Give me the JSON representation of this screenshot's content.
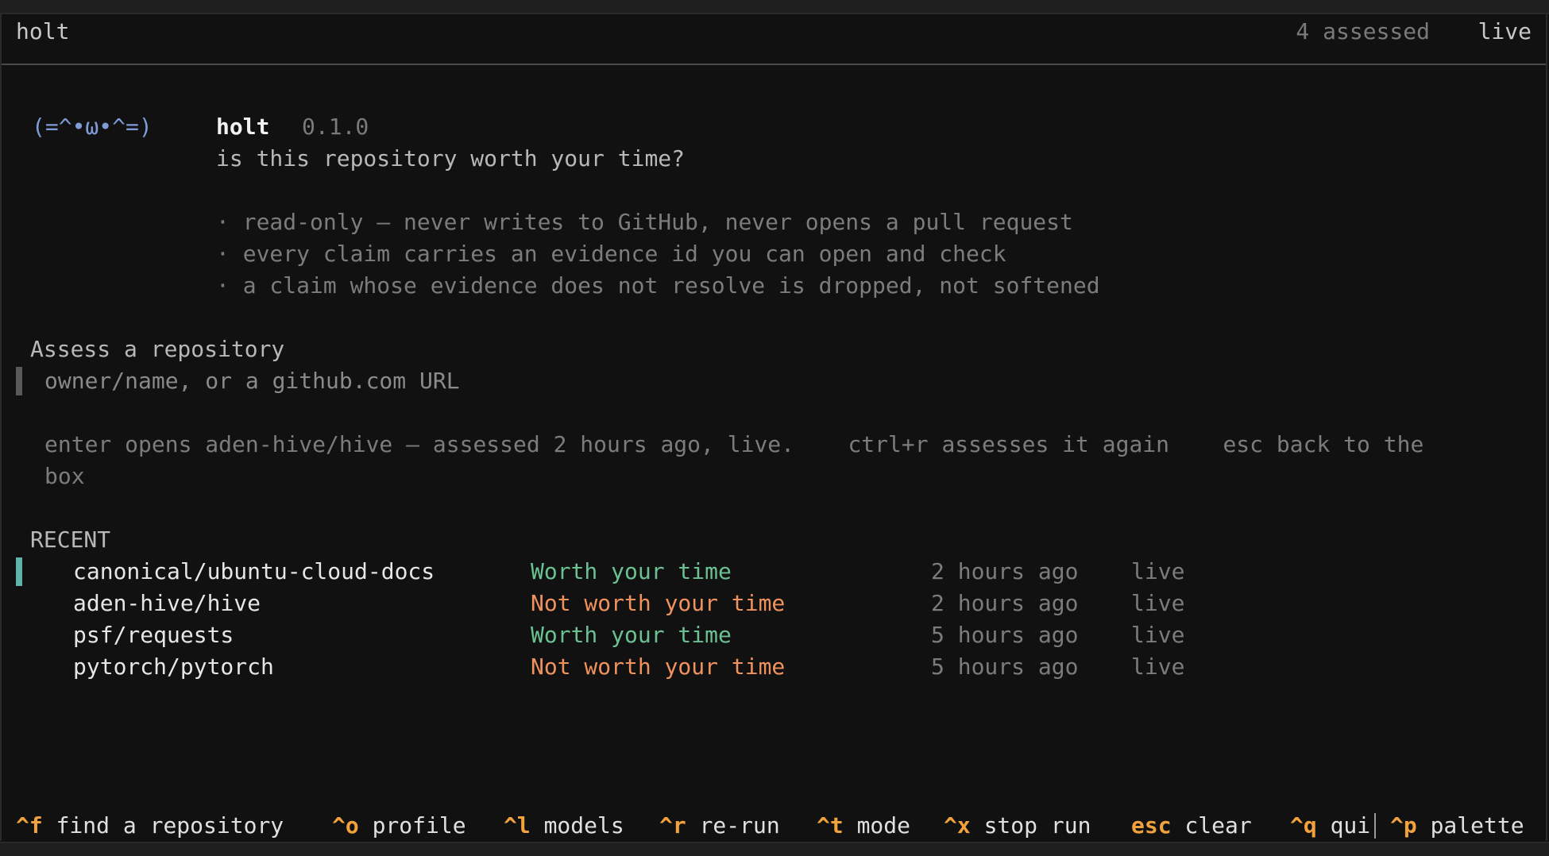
{
  "header": {
    "title": "holt",
    "assessed_count": "4 assessed",
    "status": "live"
  },
  "intro": {
    "mascot": "(=^•ω•^=)",
    "app_name": "holt",
    "version": "0.1.0",
    "tagline": "is this repository worth your time?",
    "bullets": [
      "· read-only — never writes to GitHub, never opens a pull request",
      "· every claim carries an evidence id you can open and check",
      "· a claim whose evidence does not resolve is dropped, not softened"
    ]
  },
  "assess": {
    "title": "Assess a repository",
    "placeholder": "owner/name, or a github.com URL",
    "hint_line1": "enter opens aden-hive/hive — assessed 2 hours ago, live.    ctrl+r assesses it again    esc back to the",
    "hint_line2": "box"
  },
  "recent": {
    "title": "RECENT",
    "rows": [
      {
        "repo": "canonical/ubuntu-cloud-docs",
        "verdict": "Worth your time",
        "time": "2 hours ago",
        "status": "live"
      },
      {
        "repo": "aden-hive/hive",
        "verdict": "Not worth your time",
        "time": "2 hours ago",
        "status": "live"
      },
      {
        "repo": "psf/requests",
        "verdict": "Worth your time",
        "time": "5 hours ago",
        "status": "live"
      },
      {
        "repo": "pytorch/pytorch",
        "verdict": "Not worth your time",
        "time": "5 hours ago",
        "status": "live"
      }
    ]
  },
  "colors": {
    "accent_key": "#f2a23c",
    "verdict_good": "#6cc193",
    "verdict_bad": "#f0925e",
    "selection_marker": "#5fb3a8",
    "mascot": "#7f9cd8"
  },
  "footer": {
    "shortcuts": [
      {
        "key": "^f",
        "label": "find a repository"
      },
      {
        "key": "^o",
        "label": "profile"
      },
      {
        "key": "^l",
        "label": "models"
      },
      {
        "key": "^r",
        "label": "re-run"
      },
      {
        "key": "^t",
        "label": "mode"
      },
      {
        "key": "^x",
        "label": "stop run"
      },
      {
        "key": "esc",
        "label": "clear"
      },
      {
        "key": "^q",
        "label": "qui"
      },
      {
        "key": "^p",
        "label": "palette"
      }
    ]
  }
}
